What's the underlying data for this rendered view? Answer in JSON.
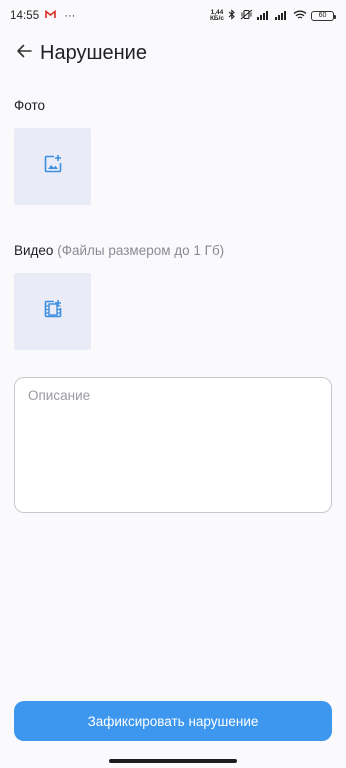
{
  "status_bar": {
    "time": "14:55",
    "dots": "···",
    "net_speed_value": "1,44",
    "net_speed_unit": "КБ/с",
    "battery": "60",
    "gmail_icon": "gmail-icon",
    "bluetooth_icon": "bluetooth-icon",
    "mute_icon": "vibrate-off-icon",
    "signal_icon": "signal-icon",
    "wifi_icon": "wifi-icon"
  },
  "header": {
    "back_icon": "arrow-back-icon",
    "title": "Нарушение"
  },
  "photo": {
    "label": "Фото",
    "icon": "add-photo-icon"
  },
  "video": {
    "label": "Видео",
    "hint": "(Файлы размером до 1 Гб)",
    "icon": "add-video-icon"
  },
  "description": {
    "placeholder": "Описание",
    "value": ""
  },
  "submit": {
    "label": "Зафиксировать нарушение"
  },
  "colors": {
    "accent": "#3e97ee",
    "tile_bg": "#e9ebf6",
    "icon_blue": "#3d8fe0"
  }
}
